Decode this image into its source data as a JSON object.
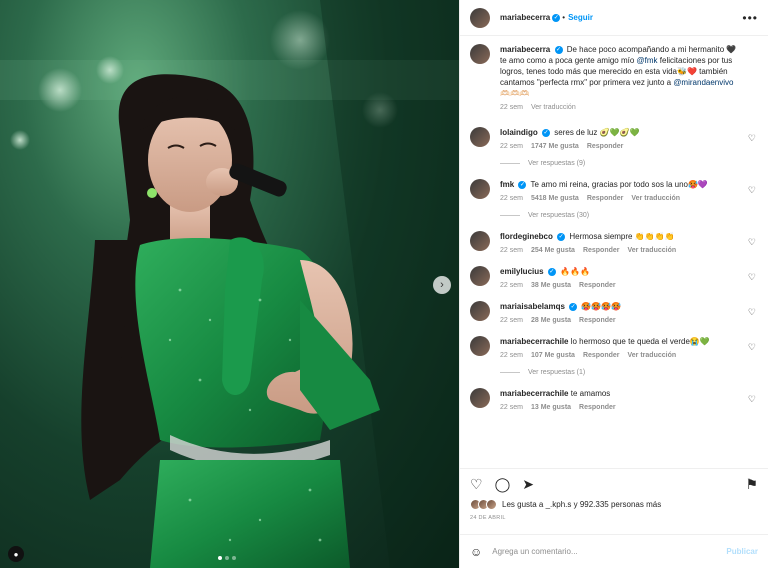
{
  "post": {
    "author": "mariabecerra",
    "follow_label": "Seguir",
    "more_icon": "more-horizontal-icon",
    "next_icon": "chevron-right-icon"
  },
  "caption": {
    "username": "mariabecerra",
    "text_parts": [
      "De hace poco acompañando a mi hermanito 🖤 te amo como a poca gente amigo mío ",
      "@fmk",
      " felicitaciones por tus logros, tenes todo más que merecido en esta vida🐝❤️ también cantamos \"perfecta rmx\" por primera vez junto a ",
      "@mirandaenvivo",
      " 🫶🏻🫶🏻🫶🏻"
    ],
    "time": "22 sem",
    "translate": "Ver traducción"
  },
  "comments": [
    {
      "username": "lolaindigo",
      "verified": true,
      "text": "seres de luz 🥑💚🥑💚",
      "time": "22 sem",
      "likes": "1747 Me gusta",
      "reply": "Responder",
      "translate": "",
      "replies": "Ver respuestas (9)"
    },
    {
      "username": "fmk",
      "verified": true,
      "text": "Te amo mi reina, gracias por todo sos la uno🥵💜",
      "time": "22 sem",
      "likes": "5418 Me gusta",
      "reply": "Responder",
      "translate": "Ver traducción",
      "replies": "Ver respuestas (30)"
    },
    {
      "username": "flordeginebco",
      "verified": true,
      "text": "Hermosa siempre 👏👏👏👏",
      "time": "22 sem",
      "likes": "254 Me gusta",
      "reply": "Responder",
      "translate": "Ver traducción",
      "replies": ""
    },
    {
      "username": "emilylucius",
      "verified": true,
      "text": "🔥🔥🔥",
      "time": "22 sem",
      "likes": "38 Me gusta",
      "reply": "Responder",
      "translate": "",
      "replies": ""
    },
    {
      "username": "mariaisabelamqs",
      "verified": true,
      "text": "🥵🥵🥵🥵",
      "time": "22 sem",
      "likes": "28 Me gusta",
      "reply": "Responder",
      "translate": "",
      "replies": ""
    },
    {
      "username": "mariabecerrachile",
      "verified": false,
      "text": "lo hermoso que te queda el verde😭💚",
      "time": "22 sem",
      "likes": "107 Me gusta",
      "reply": "Responder",
      "translate": "Ver traducción",
      "replies": "Ver respuestas (1)"
    },
    {
      "username": "mariabecerrachile",
      "verified": false,
      "text": "te amamos",
      "time": "22 sem",
      "likes": "13 Me gusta",
      "reply": "Responder",
      "translate": "",
      "replies": ""
    }
  ],
  "actions": {
    "like_icon": "heart-icon",
    "comment_icon": "comment-icon",
    "share_icon": "send-icon",
    "save_icon": "bookmark-icon",
    "likes_text": "Les gusta a _.kph.s y 992.335 personas más",
    "date": "24 DE ABRIL"
  },
  "composer": {
    "placeholder": "Agrega un comentario...",
    "publish_label": "Publicar",
    "emoji_icon": "smiley-icon"
  },
  "carousel": {
    "slides": 3,
    "active": 1
  },
  "colors": {
    "accent": "#0095f6",
    "media_bg": "#16402c",
    "dress": "#1f8a45"
  }
}
